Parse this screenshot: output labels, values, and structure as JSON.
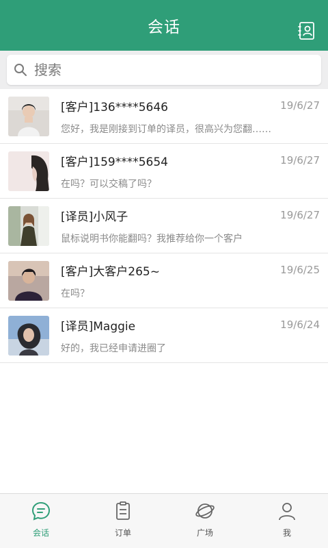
{
  "header": {
    "title": "会话"
  },
  "search": {
    "placeholder": "搜索"
  },
  "conversations": [
    {
      "name": "[客户]136****5646",
      "date": "19/6/27",
      "preview": "您好，我是刚接到订单的译员，很高兴为您翻……"
    },
    {
      "name": "[客户]159****5654",
      "date": "19/6/27",
      "preview": "在吗？可以交稿了吗？"
    },
    {
      "name": "[译员]小风子",
      "date": "19/6/27",
      "preview": "鼠标说明书你能翻吗？我推荐给你一个客户"
    },
    {
      "name": "[客户]大客户265~",
      "date": "19/6/25",
      "preview": "在吗？"
    },
    {
      "name": "[译员]Maggie",
      "date": "19/6/24",
      "preview": "好的，我已经申请进圈了"
    }
  ],
  "tabs": [
    {
      "label": "会话",
      "icon": "chat-icon",
      "active": true
    },
    {
      "label": "订单",
      "icon": "order-icon",
      "active": false
    },
    {
      "label": "广场",
      "icon": "planet-icon",
      "active": false
    },
    {
      "label": "我",
      "icon": "profile-icon",
      "active": false
    }
  ],
  "colors": {
    "brand": "#2f9e78",
    "inactive_tab": "#555555"
  }
}
